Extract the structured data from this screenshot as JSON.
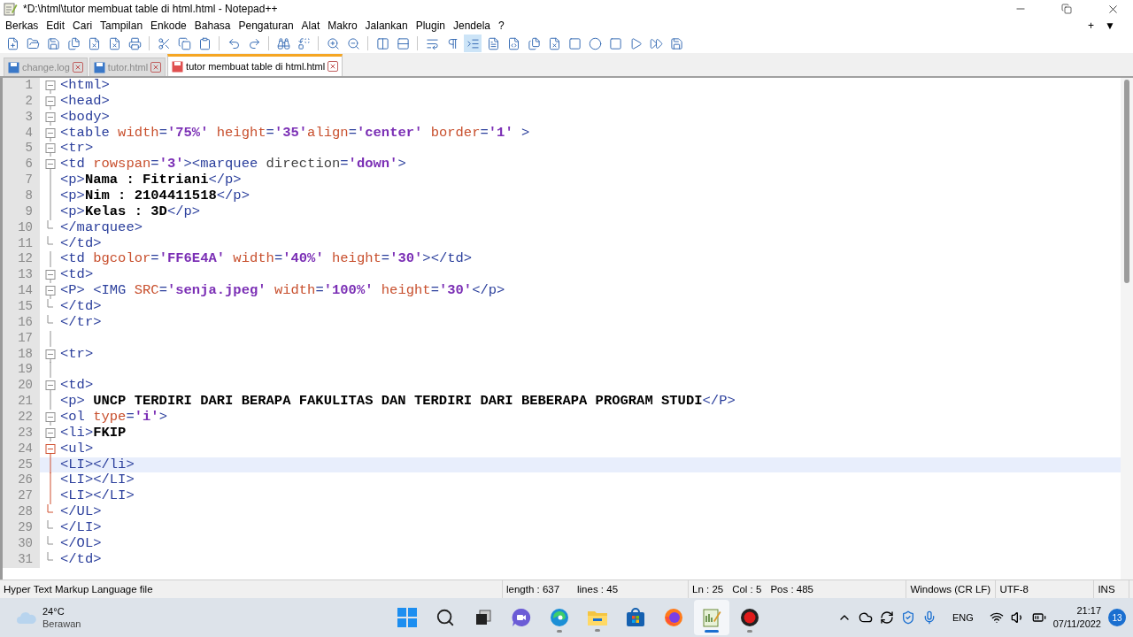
{
  "window": {
    "title": "*D:\\html\\tutor membuat table di html.html - Notepad++"
  },
  "menu": [
    "Berkas",
    "Edit",
    "Cari",
    "Tampilan",
    "Enkode",
    "Bahasa",
    "Pengaturan",
    "Alat",
    "Makro",
    "Jalankan",
    "Plugin",
    "Jendela",
    "?"
  ],
  "menu_right": [
    "+",
    "▼"
  ],
  "tabs": [
    {
      "label": "change.log",
      "selected": false,
      "modified": false
    },
    {
      "label": "tutor.html",
      "selected": false,
      "modified": false
    },
    {
      "label": "tutor membuat table di html.html",
      "selected": true,
      "modified": true
    }
  ],
  "lines": [
    {
      "number": "1",
      "fold": {
        "kind": "box",
        "current_block": false
      },
      "current": false,
      "tokens": [
        {
          "kind": "tag",
          "text": "<html>"
        }
      ]
    },
    {
      "number": "2",
      "fold": {
        "kind": "box",
        "current_block": false
      },
      "current": false,
      "tokens": [
        {
          "kind": "tag",
          "text": "<head>"
        }
      ]
    },
    {
      "number": "3",
      "fold": {
        "kind": "box",
        "current_block": false
      },
      "current": false,
      "tokens": [
        {
          "kind": "tag",
          "text": "<body>"
        }
      ]
    },
    {
      "number": "4",
      "fold": {
        "kind": "box",
        "current_block": false
      },
      "current": false,
      "tokens": [
        {
          "kind": "tag",
          "text": "<table"
        },
        {
          "kind": "attr",
          "text": " width"
        },
        {
          "kind": "tag",
          "text": "="
        },
        {
          "kind": "value",
          "text": "'75%'"
        },
        {
          "kind": "attr",
          "text": " height"
        },
        {
          "kind": "tag",
          "text": "="
        },
        {
          "kind": "value",
          "text": "'35'"
        },
        {
          "kind": "attr",
          "text": "align"
        },
        {
          "kind": "tag",
          "text": "="
        },
        {
          "kind": "value",
          "text": "'center'"
        },
        {
          "kind": "attr",
          "text": " border"
        },
        {
          "kind": "tag",
          "text": "="
        },
        {
          "kind": "value",
          "text": "'1'"
        },
        {
          "kind": "tag",
          "text": " >"
        }
      ]
    },
    {
      "number": "5",
      "fold": {
        "kind": "box",
        "current_block": false
      },
      "current": false,
      "tokens": [
        {
          "kind": "tag",
          "text": "<tr>"
        }
      ]
    },
    {
      "number": "6",
      "fold": {
        "kind": "box",
        "current_block": false
      },
      "current": false,
      "tokens": [
        {
          "kind": "tag",
          "text": "<td"
        },
        {
          "kind": "attr",
          "text": " rowspan"
        },
        {
          "kind": "tag",
          "text": "="
        },
        {
          "kind": "value",
          "text": "'3'"
        },
        {
          "kind": "tag",
          "text": "><marquee"
        },
        {
          "kind": "unknown",
          "text": " direction"
        },
        {
          "kind": "tag",
          "text": "="
        },
        {
          "kind": "value",
          "text": "'down'"
        },
        {
          "kind": "tag",
          "text": ">"
        }
      ]
    },
    {
      "number": "7",
      "fold": {
        "kind": "line",
        "current_block": false
      },
      "current": false,
      "tokens": [
        {
          "kind": "tag",
          "text": "<p>"
        },
        {
          "kind": "text",
          "text": "Nama : Fitriani"
        },
        {
          "kind": "tag",
          "text": "</p>"
        }
      ]
    },
    {
      "number": "8",
      "fold": {
        "kind": "line",
        "current_block": false
      },
      "current": false,
      "tokens": [
        {
          "kind": "tag",
          "text": "<p>"
        },
        {
          "kind": "text",
          "text": "Nim : 2104411518"
        },
        {
          "kind": "tag",
          "text": "</p>"
        }
      ]
    },
    {
      "number": "9",
      "fold": {
        "kind": "line",
        "current_block": false
      },
      "current": false,
      "tokens": [
        {
          "kind": "tag",
          "text": "<p>"
        },
        {
          "kind": "text",
          "text": "Kelas : 3D"
        },
        {
          "kind": "tag",
          "text": "</p>"
        }
      ]
    },
    {
      "number": "10",
      "fold": {
        "kind": "end",
        "current_block": false
      },
      "current": false,
      "tokens": [
        {
          "kind": "tag",
          "text": "</marquee>"
        }
      ]
    },
    {
      "number": "11",
      "fold": {
        "kind": "end",
        "current_block": false
      },
      "current": false,
      "tokens": [
        {
          "kind": "tag",
          "text": "</td>"
        }
      ]
    },
    {
      "number": "12",
      "fold": {
        "kind": "line",
        "current_block": false
      },
      "current": false,
      "tokens": [
        {
          "kind": "tag",
          "text": "<td"
        },
        {
          "kind": "attr",
          "text": " bgcolor"
        },
        {
          "kind": "tag",
          "text": "="
        },
        {
          "kind": "value",
          "text": "'FF6E4A'"
        },
        {
          "kind": "attr",
          "text": " width"
        },
        {
          "kind": "tag",
          "text": "="
        },
        {
          "kind": "value",
          "text": "'40%'"
        },
        {
          "kind": "attr",
          "text": " height"
        },
        {
          "kind": "tag",
          "text": "="
        },
        {
          "kind": "value",
          "text": "'30'"
        },
        {
          "kind": "tag",
          "text": "></td>"
        }
      ]
    },
    {
      "number": "13",
      "fold": {
        "kind": "box",
        "current_block": false
      },
      "current": false,
      "tokens": [
        {
          "kind": "tag",
          "text": "<td>"
        }
      ]
    },
    {
      "number": "14",
      "fold": {
        "kind": "box",
        "current_block": false
      },
      "current": false,
      "tokens": [
        {
          "kind": "tag",
          "text": "<P> <IMG"
        },
        {
          "kind": "attr",
          "text": " SRC"
        },
        {
          "kind": "tag",
          "text": "="
        },
        {
          "kind": "value",
          "text": "'senja.jpeg'"
        },
        {
          "kind": "attr",
          "text": " width"
        },
        {
          "kind": "tag",
          "text": "="
        },
        {
          "kind": "value",
          "text": "'100%'"
        },
        {
          "kind": "attr",
          "text": " height"
        },
        {
          "kind": "tag",
          "text": "="
        },
        {
          "kind": "value",
          "text": "'30'"
        },
        {
          "kind": "tag",
          "text": "</p>"
        }
      ]
    },
    {
      "number": "15",
      "fold": {
        "kind": "end",
        "current_block": false
      },
      "current": false,
      "tokens": [
        {
          "kind": "tag",
          "text": "</td>"
        }
      ]
    },
    {
      "number": "16",
      "fold": {
        "kind": "end",
        "current_block": false
      },
      "current": false,
      "tokens": [
        {
          "kind": "tag",
          "text": "</tr>"
        }
      ]
    },
    {
      "number": "17",
      "fold": {
        "kind": "line",
        "current_block": false
      },
      "current": false
    },
    {
      "number": "18",
      "fold": {
        "kind": "box",
        "current_block": false
      },
      "current": false,
      "tokens": [
        {
          "kind": "tag",
          "text": "<tr>"
        }
      ]
    },
    {
      "number": "19",
      "fold": {
        "kind": "line",
        "current_block": false
      },
      "current": false
    },
    {
      "number": "20",
      "fold": {
        "kind": "box",
        "current_block": false
      },
      "current": false,
      "tokens": [
        {
          "kind": "tag",
          "text": "<td>"
        }
      ]
    },
    {
      "number": "21",
      "fold": {
        "kind": "line",
        "current_block": false
      },
      "current": false,
      "tokens": [
        {
          "kind": "tag",
          "text": "<p>"
        },
        {
          "kind": "text",
          "text": " UNCP TERDIRI DARI BERAPA FAKULITAS DAN TERDIRI DARI BEBERAPA PROGRAM STUDI"
        },
        {
          "kind": "tag",
          "text": "</P>"
        }
      ]
    },
    {
      "number": "22",
      "fold": {
        "kind": "box",
        "current_block": false
      },
      "current": false,
      "tokens": [
        {
          "kind": "tag",
          "text": "<ol"
        },
        {
          "kind": "attr",
          "text": " type"
        },
        {
          "kind": "tag",
          "text": "="
        },
        {
          "kind": "value",
          "text": "'i'"
        },
        {
          "kind": "tag",
          "text": ">"
        }
      ]
    },
    {
      "number": "23",
      "fold": {
        "kind": "box",
        "current_block": false
      },
      "current": false,
      "tokens": [
        {
          "kind": "tag",
          "text": "<li>"
        },
        {
          "kind": "text",
          "text": "FKIP"
        }
      ]
    },
    {
      "number": "24",
      "fold": {
        "kind": "box",
        "current_block": true
      },
      "current": false,
      "tokens": [
        {
          "kind": "tag",
          "text": "<ul>"
        }
      ]
    },
    {
      "number": "25",
      "fold": {
        "kind": "line",
        "current_block": true
      },
      "current": true,
      "tokens": [
        {
          "kind": "tag",
          "text": "<LI></li>"
        }
      ]
    },
    {
      "number": "26",
      "fold": {
        "kind": "line",
        "current_block": true
      },
      "current": false,
      "tokens": [
        {
          "kind": "tag",
          "text": "<LI></LI>"
        }
      ]
    },
    {
      "number": "27",
      "fold": {
        "kind": "line",
        "current_block": true
      },
      "current": false,
      "tokens": [
        {
          "kind": "tag",
          "text": "<LI></LI>"
        }
      ]
    },
    {
      "number": "28",
      "fold": {
        "kind": "end",
        "current_block": true
      },
      "current": false,
      "tokens": [
        {
          "kind": "tag",
          "text": "</UL>"
        }
      ]
    },
    {
      "number": "29",
      "fold": {
        "kind": "end",
        "current_block": false
      },
      "current": false,
      "tokens": [
        {
          "kind": "tag",
          "text": "</LI>"
        }
      ]
    },
    {
      "number": "30",
      "fold": {
        "kind": "end",
        "current_block": false
      },
      "current": false,
      "tokens": [
        {
          "kind": "tag",
          "text": "</OL>"
        }
      ]
    },
    {
      "number": "31",
      "fold": {
        "kind": "end",
        "current_block": false
      },
      "current": false,
      "tokens": [
        {
          "kind": "tag",
          "text": "</td>"
        }
      ]
    }
  ],
  "status_bar": {
    "file_type": "Hyper Text Markup Language file",
    "length": "length : 637",
    "lines": "lines : 45",
    "ln": "Ln : 25",
    "col": "Col : 5",
    "pos": "Pos : 485",
    "eol": "Windows (CR LF)",
    "encoding": "UTF-8",
    "mode": "INS"
  },
  "taskbar": {
    "weather": {
      "temperature": "24°C",
      "condition": "Berawan"
    },
    "apps": [
      {
        "kind": "start",
        "running": false,
        "active": false
      },
      {
        "kind": "search",
        "running": false,
        "active": false
      },
      {
        "kind": "taskview",
        "running": false,
        "active": false
      },
      {
        "kind": "chat",
        "running": false,
        "active": false
      },
      {
        "kind": "edge",
        "running": true,
        "active": false
      },
      {
        "kind": "explorer",
        "running": true,
        "active": false
      },
      {
        "kind": "store",
        "running": false,
        "active": false
      },
      {
        "kind": "firefox",
        "running": false,
        "active": false
      },
      {
        "kind": "notepad",
        "running": true,
        "active": true
      },
      {
        "kind": "recorder",
        "running": true,
        "active": false
      }
    ],
    "language": "ENG",
    "time": "21:17",
    "date": "07/11/2022",
    "notifications": "13"
  }
}
